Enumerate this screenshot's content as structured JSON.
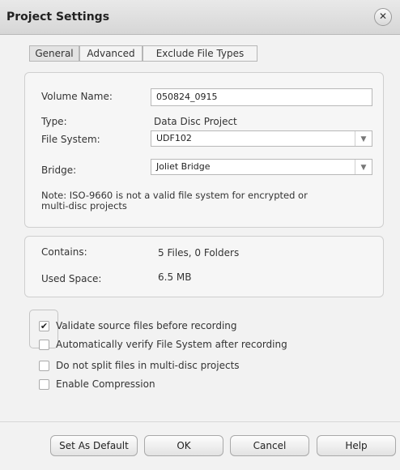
{
  "window": {
    "title": "Project Settings",
    "close_glyph": "✕"
  },
  "tabs": [
    {
      "label": "General",
      "active": true
    },
    {
      "label": "Advanced",
      "active": false
    },
    {
      "label": "Exclude File Types",
      "active": false
    }
  ],
  "general": {
    "volume_name_label": "Volume Name:",
    "volume_name_value": "050824_0915",
    "type_label": "Type:",
    "type_value": "Data Disc Project",
    "file_system_label": "File System:",
    "file_system_value": "UDF102",
    "bridge_label": "Bridge:",
    "bridge_value": "Joliet Bridge",
    "note_line1": "Note: ISO-9660 is not a valid file system for encrypted or",
    "note_line2": "multi-disc projects"
  },
  "summary": {
    "contains_label": "Contains:",
    "contains_value": "5 Files, 0 Folders",
    "used_space_label": "Used Space:",
    "used_space_value": "6.5 MB"
  },
  "options": [
    {
      "label": "Validate source files before recording",
      "checked": true
    },
    {
      "label": "Automatically verify File System after recording",
      "checked": false
    },
    {
      "label": "Do not split files in multi-disc projects",
      "checked": false
    },
    {
      "label": "Enable Compression",
      "checked": false
    }
  ],
  "buttons": {
    "set_as_default": "Set As Default",
    "ok": "OK",
    "cancel": "Cancel",
    "help": "Help"
  },
  "icons": {
    "dropdown": "chevron-down-icon",
    "check": "check-icon",
    "close": "close-icon"
  },
  "glyphs": {
    "dropdown_arrow": "▼",
    "check_mark": "✔"
  }
}
